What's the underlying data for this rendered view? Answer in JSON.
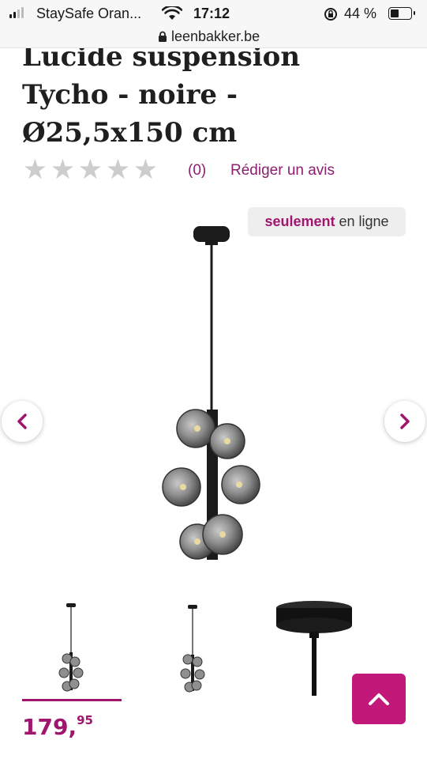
{
  "status_bar": {
    "carrier": "StaySafe Oran...",
    "time": "17:12",
    "battery_percent": "44 %",
    "battery_level": 0.44
  },
  "browser": {
    "url": "leenbakker.be"
  },
  "product": {
    "title_lines": [
      "Lucide suspension",
      "Tycho - noire -",
      "Ø25,5x150 cm"
    ],
    "rating": {
      "stars": 0,
      "max_stars": 5,
      "count_label": "(0)"
    },
    "review_link": "Rédiger un avis",
    "badge": {
      "strong": "seulement",
      "rest": " en ligne"
    },
    "price": {
      "integer": "179,",
      "decimals": "95"
    }
  },
  "carousel": {
    "prev_icon": "chevron-left-icon",
    "next_icon": "chevron-right-icon",
    "selected_thumbnail": 1,
    "thumbnails": [
      "thumbnail-full-lamp",
      "thumbnail-lamp-side",
      "thumbnail-ceiling-canopy"
    ]
  },
  "colors": {
    "accent": "#a0166f",
    "button": "#c2187a",
    "star_empty": "#cdcdcd"
  },
  "back_to_top_icon": "chevron-up-icon"
}
